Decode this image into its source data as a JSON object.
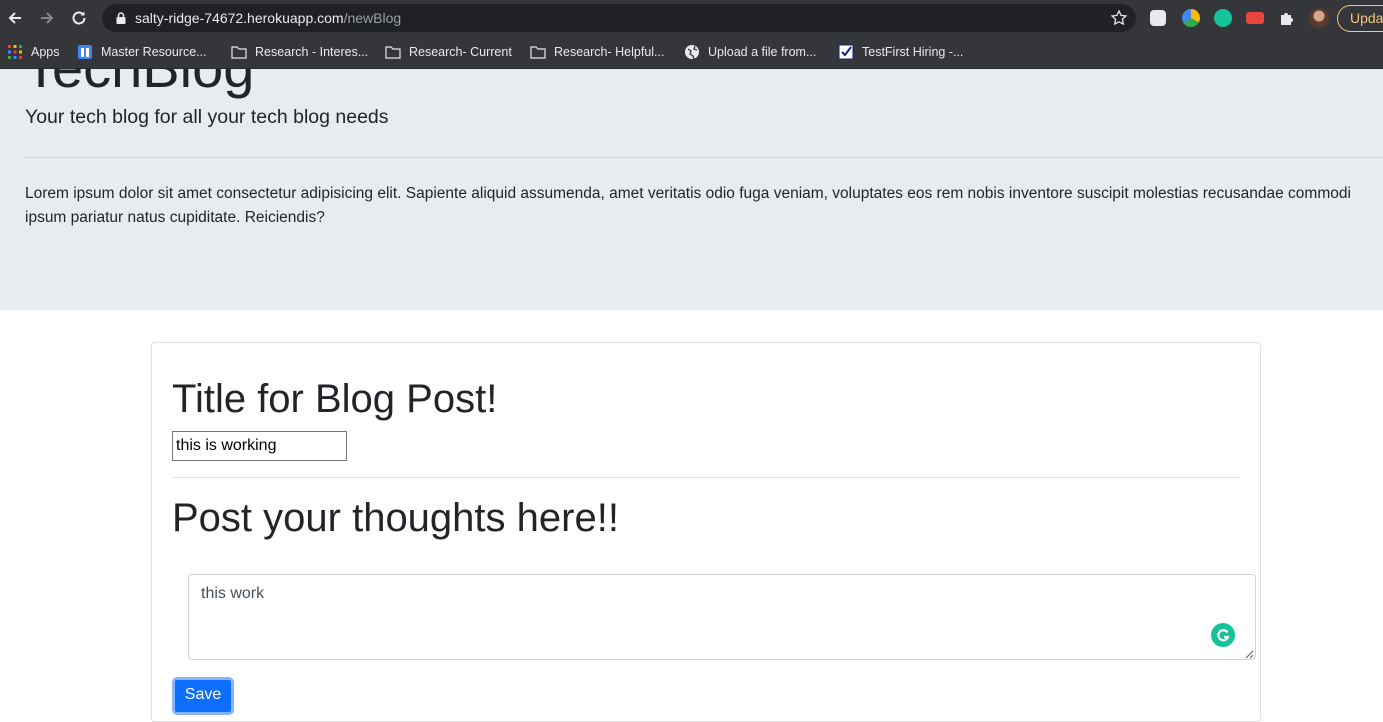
{
  "browser": {
    "url_host": "salty-ridge-74672.herokuapp.com",
    "url_path": "/newBlog",
    "update_label": "Upda",
    "bookmarks": [
      {
        "label": "Apps",
        "icon": "apps-grid-icon"
      },
      {
        "label": "Master Resource...",
        "icon": "doc-icon"
      },
      {
        "label": "Research - Interes...",
        "icon": "folder-icon"
      },
      {
        "label": "Research- Current",
        "icon": "folder-icon"
      },
      {
        "label": "Research- Helpful...",
        "icon": "folder-icon"
      },
      {
        "label": "Upload a file from...",
        "icon": "globe-icon"
      },
      {
        "label": "TestFirst Hiring -...",
        "icon": "checkbox-icon"
      }
    ]
  },
  "page": {
    "brand": "TechBlog",
    "lead": "Your tech blog for all your tech blog needs",
    "lorem": "Lorem ipsum dolor sit amet consectetur adipisicing elit. Sapiente aliquid assumenda, amet veritatis odio fuga veniam, voluptates eos rem nobis inventore suscipit molestias recusandae commodi ipsum pariatur natus cupiditate. Reiciendis?"
  },
  "form": {
    "title_heading": "Title for Blog Post!",
    "title_value": "this is working",
    "post_heading": "Post your thoughts here!!",
    "post_value": "this work",
    "save_label": "Save"
  },
  "colors": {
    "chrome": "#35363a",
    "jumbotron": "#e9ecef",
    "primary": "#0d6efd",
    "grammarly": "#15c39a"
  }
}
